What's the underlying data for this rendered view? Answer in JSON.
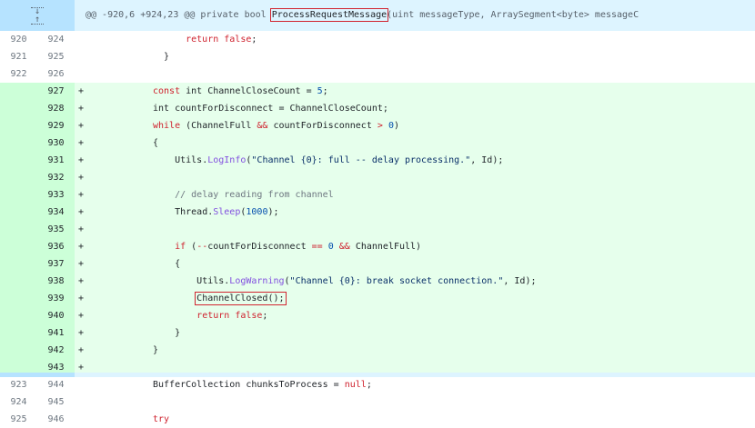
{
  "hunk": {
    "prefix": "@@ -920,6 +924,23 @@ private bool ",
    "method": "ProcessRequestMessage",
    "suffix": "(uint messageType, ArraySegment<byte> messageC",
    "expand_up_icon": "arrow-up-icon",
    "expand_down_icon": "arrow-down-icon"
  },
  "lines": [
    {
      "type": "ctx",
      "old": "920",
      "new": "924",
      "sign": "",
      "indent": "      ",
      "tokens": [
        {
          "t": "return false",
          "c": "kw"
        },
        {
          "t": ";",
          "c": ""
        }
      ]
    },
    {
      "type": "ctx",
      "old": "921",
      "new": "925",
      "sign": "",
      "indent": "  ",
      "tokens": [
        {
          "t": "}",
          "c": ""
        }
      ]
    },
    {
      "type": "ctx",
      "old": "922",
      "new": "926",
      "sign": "",
      "indent": "",
      "tokens": []
    },
    {
      "type": "add",
      "old": "",
      "new": "927",
      "sign": "+",
      "indent": "",
      "tokens": [
        {
          "t": "const",
          "c": "kw"
        },
        {
          "t": " int ChannelCloseCount = ",
          "c": ""
        },
        {
          "t": "5",
          "c": "nm"
        },
        {
          "t": ";",
          "c": ""
        }
      ]
    },
    {
      "type": "add",
      "old": "",
      "new": "928",
      "sign": "+",
      "indent": "",
      "tokens": [
        {
          "t": "int countForDisconnect = ChannelCloseCount;",
          "c": ""
        }
      ]
    },
    {
      "type": "add",
      "old": "",
      "new": "929",
      "sign": "+",
      "indent": "",
      "tokens": [
        {
          "t": "while",
          "c": "kw"
        },
        {
          "t": " (ChannelFull ",
          "c": ""
        },
        {
          "t": "&&",
          "c": "kw"
        },
        {
          "t": " countForDisconnect ",
          "c": ""
        },
        {
          "t": ">",
          "c": "kw"
        },
        {
          "t": " ",
          "c": ""
        },
        {
          "t": "0",
          "c": "nm"
        },
        {
          "t": ")",
          "c": ""
        }
      ]
    },
    {
      "type": "add",
      "old": "",
      "new": "930",
      "sign": "+",
      "indent": "",
      "tokens": [
        {
          "t": "{",
          "c": ""
        }
      ]
    },
    {
      "type": "add",
      "old": "",
      "new": "931",
      "sign": "+",
      "indent": "    ",
      "tokens": [
        {
          "t": "Utils.",
          "c": ""
        },
        {
          "t": "LogInfo",
          "c": "fn"
        },
        {
          "t": "(",
          "c": ""
        },
        {
          "t": "\"Channel {0}: full -- delay processing.\"",
          "c": "str"
        },
        {
          "t": ", Id);",
          "c": ""
        }
      ]
    },
    {
      "type": "add",
      "old": "",
      "new": "932",
      "sign": "+",
      "indent": "",
      "tokens": []
    },
    {
      "type": "add",
      "old": "",
      "new": "933",
      "sign": "+",
      "indent": "    ",
      "tokens": [
        {
          "t": "// delay reading from channel",
          "c": "cm"
        }
      ]
    },
    {
      "type": "add",
      "old": "",
      "new": "934",
      "sign": "+",
      "indent": "    ",
      "tokens": [
        {
          "t": "Thread.",
          "c": ""
        },
        {
          "t": "Sleep",
          "c": "fn"
        },
        {
          "t": "(",
          "c": ""
        },
        {
          "t": "1000",
          "c": "nm"
        },
        {
          "t": ");",
          "c": ""
        }
      ]
    },
    {
      "type": "add",
      "old": "",
      "new": "935",
      "sign": "+",
      "indent": "",
      "tokens": []
    },
    {
      "type": "add",
      "old": "",
      "new": "936",
      "sign": "+",
      "indent": "    ",
      "tokens": [
        {
          "t": "if",
          "c": "kw"
        },
        {
          "t": " (",
          "c": ""
        },
        {
          "t": "--",
          "c": "kw"
        },
        {
          "t": "countForDisconnect ",
          "c": ""
        },
        {
          "t": "==",
          "c": "kw"
        },
        {
          "t": " ",
          "c": ""
        },
        {
          "t": "0",
          "c": "nm"
        },
        {
          "t": " ",
          "c": ""
        },
        {
          "t": "&&",
          "c": "kw"
        },
        {
          "t": " ChannelFull)",
          "c": ""
        }
      ]
    },
    {
      "type": "add",
      "old": "",
      "new": "937",
      "sign": "+",
      "indent": "    ",
      "tokens": [
        {
          "t": "{",
          "c": ""
        }
      ]
    },
    {
      "type": "add",
      "old": "",
      "new": "938",
      "sign": "+",
      "indent": "        ",
      "tokens": [
        {
          "t": "Utils.",
          "c": ""
        },
        {
          "t": "LogWarning",
          "c": "fn"
        },
        {
          "t": "(",
          "c": ""
        },
        {
          "t": "\"Channel {0}: break socket connection.\"",
          "c": "str"
        },
        {
          "t": ", Id);",
          "c": ""
        }
      ]
    },
    {
      "type": "add",
      "old": "",
      "new": "939",
      "sign": "+",
      "indent": "        ",
      "tokens": [
        {
          "t": "ChannelClosed();",
          "c": "",
          "box": true
        }
      ]
    },
    {
      "type": "add",
      "old": "",
      "new": "940",
      "sign": "+",
      "indent": "        ",
      "tokens": [
        {
          "t": "return false",
          "c": "kw"
        },
        {
          "t": ";",
          "c": ""
        }
      ]
    },
    {
      "type": "add",
      "old": "",
      "new": "941",
      "sign": "+",
      "indent": "    ",
      "tokens": [
        {
          "t": "}",
          "c": ""
        }
      ]
    },
    {
      "type": "add",
      "old": "",
      "new": "942",
      "sign": "+",
      "indent": "",
      "tokens": [
        {
          "t": "}",
          "c": ""
        }
      ]
    },
    {
      "type": "add",
      "old": "",
      "new": "943",
      "sign": "+",
      "indent": "",
      "tokens": []
    },
    {
      "type": "ctx",
      "old": "923",
      "new": "944",
      "sign": "",
      "indent": "",
      "tokens": [
        {
          "t": "BufferCollection chunksToProcess = ",
          "c": ""
        },
        {
          "t": "null",
          "c": "kw"
        },
        {
          "t": ";",
          "c": ""
        }
      ]
    },
    {
      "type": "ctx",
      "old": "924",
      "new": "945",
      "sign": "",
      "indent": "",
      "tokens": []
    },
    {
      "type": "ctx",
      "old": "925",
      "new": "946",
      "sign": "",
      "indent": "",
      "tokens": [
        {
          "t": "try",
          "c": "kw"
        }
      ]
    }
  ]
}
